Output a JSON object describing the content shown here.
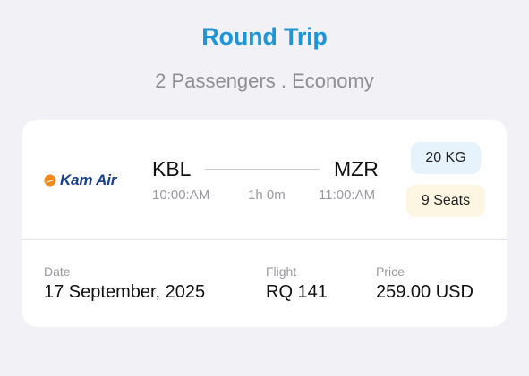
{
  "header": {
    "title": "Round Trip",
    "subtitle": "2 Passengers . Economy"
  },
  "flight_card": {
    "airline": {
      "name": "Kam Air",
      "logo_icon": "kam-air-logo-icon",
      "brand_color": "#1a3f8f",
      "accent_color": "#f08a1c"
    },
    "origin": {
      "code": "KBL",
      "time": "10:00:AM"
    },
    "destination": {
      "code": "MZR",
      "time": "11:00:AM"
    },
    "duration": "1h 0m",
    "baggage": "20 KG",
    "seats": "9 Seats",
    "details": {
      "date_label": "Date",
      "date_value": "17 September, 2025",
      "flight_label": "Flight",
      "flight_value": "RQ 141",
      "price_label": "Price",
      "price_value": "259.00 USD"
    }
  },
  "colors": {
    "title": "#1e96d6",
    "background": "#f1f1f6",
    "baggage_badge": "#e6f2fc",
    "seats_badge": "#fcf6e2"
  }
}
